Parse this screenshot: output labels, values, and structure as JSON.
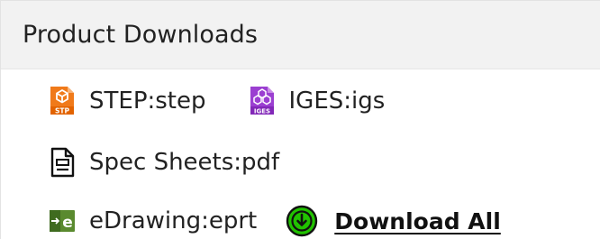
{
  "panel": {
    "title": "Product Downloads"
  },
  "downloads": {
    "step": {
      "label": "STEP:step",
      "icon": "step-file-icon",
      "badge": "STP",
      "color": "#f07a1a"
    },
    "iges": {
      "label": "IGES:igs",
      "icon": "iges-file-icon",
      "badge": "IGES",
      "color": "#9b3fd1"
    },
    "spec": {
      "label": "Spec Sheets:pdf",
      "icon": "document-icon"
    },
    "edrawing": {
      "label": "eDrawing:eprt",
      "icon": "edrawing-icon",
      "color": "#4f7a2d"
    },
    "download_all": {
      "label": "Download All",
      "icon": "download-circle-icon",
      "color": "#21c200"
    }
  }
}
